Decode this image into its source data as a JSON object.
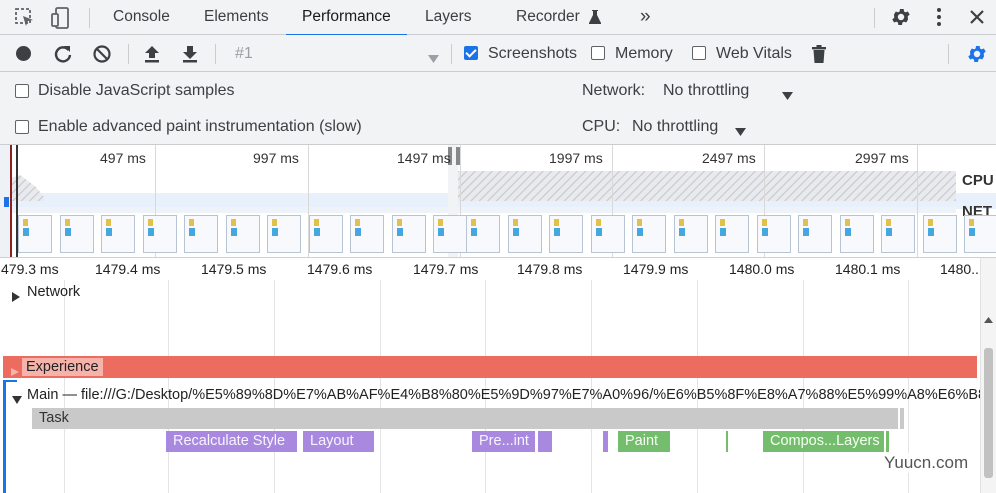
{
  "tabs": [
    {
      "label": "Console"
    },
    {
      "label": "Elements"
    },
    {
      "label": "Performance"
    },
    {
      "label": "Layers"
    },
    {
      "label": "Recorder"
    }
  ],
  "tab_overflow": "»",
  "toolbar": {
    "profile_select": "#1",
    "screenshots_label": "Screenshots",
    "memory_label": "Memory",
    "web_vitals_label": "Web Vitals",
    "screenshots_checked": true,
    "memory_checked": false,
    "web_vitals_checked": false
  },
  "settings": {
    "disable_js_label": "Disable JavaScript samples",
    "paint_label": "Enable advanced paint instrumentation (slow)",
    "network_label": "Network:",
    "network_value": "No throttling",
    "cpu_label": "CPU:",
    "cpu_value": "No throttling"
  },
  "overview": {
    "labels": [
      "497 ms",
      "997 ms",
      "1497 ms",
      "1997 ms",
      "2497 ms",
      "2997 ms"
    ],
    "cpu_label": "CPU",
    "net_label": "NET"
  },
  "ruler": {
    "labels": [
      "479.3 ms",
      "1479.4 ms",
      "1479.5 ms",
      "1479.6 ms",
      "1479.7 ms",
      "1479.8 ms",
      "1479.9 ms",
      "1480.0 ms",
      "1480.1 ms",
      "1480.."
    ]
  },
  "tracks": {
    "network": "Network",
    "experience": "Experience",
    "main": "Main — file:///G:/Desktop/%E5%89%8D%E7%AB%AF%E4%B8%80%E5%9D%97%E7%A0%96/%E6%B5%8F%E8%A7%88%E5%99%A8%E6%B8%",
    "task": "Task"
  },
  "events": [
    {
      "label": "Recalculate Style"
    },
    {
      "label": "Layout"
    },
    {
      "label": "Pre...int"
    },
    {
      "label": "Paint"
    },
    {
      "label": "Compos...Layers"
    }
  ],
  "watermark": "Yuucn.com",
  "colors": {
    "accent": "#1a73e8",
    "experience": "#ec6c5f",
    "purple": "#a989df",
    "green": "#74bd6c"
  }
}
